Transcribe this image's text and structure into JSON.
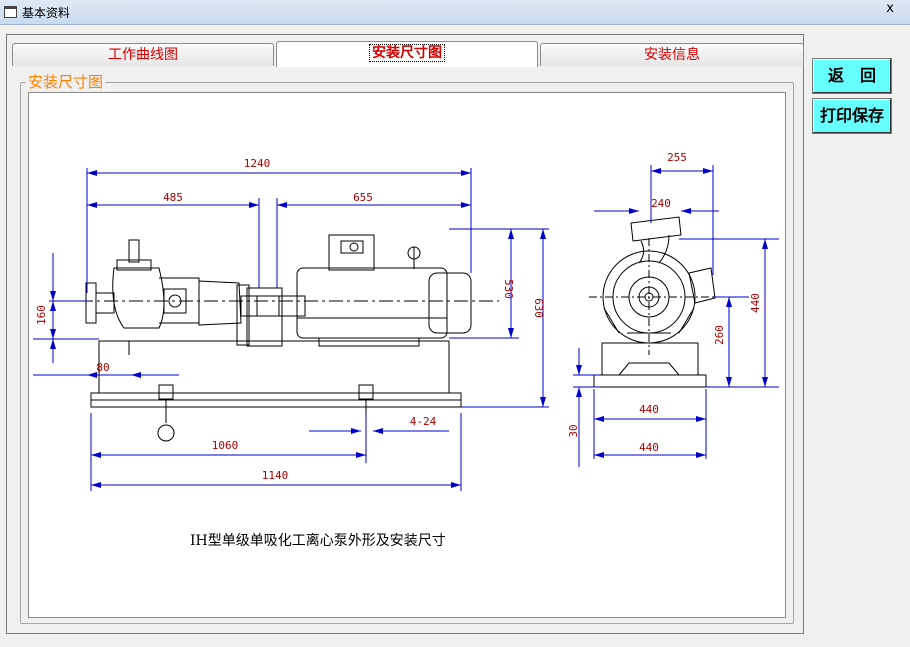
{
  "window": {
    "title": "基本资料",
    "close_glyph": "x"
  },
  "tabs": [
    {
      "label": "工作曲线图",
      "active": false
    },
    {
      "label": "安装尺寸图",
      "active": true
    },
    {
      "label": "安装信息",
      "active": false
    }
  ],
  "group": {
    "label": "安装尺寸图"
  },
  "buttons": {
    "back": "返　回",
    "print_save": "打印保存"
  },
  "drawing": {
    "caption": "IH型单级单吸化工离心泵外形及安装尺寸",
    "dims": {
      "d1240": "1240",
      "d485": "485",
      "d655": "655",
      "d530": "530",
      "d630": "630",
      "d160": "160",
      "d80": "80",
      "d1060": "1060",
      "d1140": "1140",
      "d424": "4-24",
      "d255": "255",
      "d240": "240",
      "d440v": "440",
      "d260": "260",
      "d440a": "440",
      "d440b": "440",
      "d30": "30"
    },
    "colors": {
      "dimension": "#0000cc",
      "dimension_text": "#aa0000",
      "outline": "#000000"
    }
  }
}
